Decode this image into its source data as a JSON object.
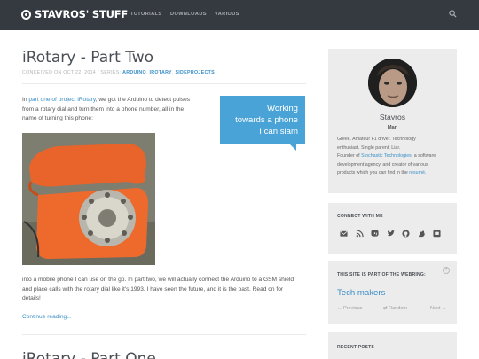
{
  "header": {
    "logo_text": "STAVROS' STUFF",
    "nav": [
      "TUTORIALS",
      "DOWNLOADS",
      "VARIOUS"
    ],
    "background": "#353a40"
  },
  "post": {
    "title": "iRotary - Part Two",
    "meta_prefix": "CONCEIVED ON OCT 22, 2014 / SERIES:",
    "tags": [
      "ARDUINO",
      "IROTARY",
      "SIDEPROJECTS"
    ],
    "intro_link": "part one of project iRotary",
    "intro_line1_a": "In ",
    "intro_line1_b": ", we got the Arduino to detect pulses",
    "intro_line2": "from a rotary dial and turn them into a phone number, all in the",
    "intro_line3": "name of turning this phone:",
    "callout_lines": [
      "Working",
      "towards a phone",
      "I can slam"
    ],
    "after_line1": "into a mobile phone I can use on the go. In part two, we will actually connect the Arduino to a GSM shield",
    "after_line2": "and place calls with the rotary dial like it's 1993. I have seen the future, and it is the past. Read on for",
    "after_line3": "details!",
    "continue": "Continue reading..."
  },
  "next_post": {
    "title": "iRotary - Part One"
  },
  "sidebar": {
    "profile": {
      "name": "Stavros",
      "role": "Man",
      "bio_line1": "Greek. Amateur F1 driver. Technology",
      "bio_line2": "enthusiast. Single parent. Liar.",
      "bio_line3_a": "Founder of ",
      "bio_line3_link": "Stochastic Technologies",
      "bio_line3_b": ", a software",
      "bio_line4": "development agency, and creator of various",
      "bio_line5_a": "products which you can find in the ",
      "bio_line5_link": "résumé",
      "bio_line5_b": "."
    },
    "connect": {
      "title": "CONNECT WITH ME",
      "icons": [
        "email-icon",
        "rss-icon",
        "mastodon-icon",
        "twitter-icon",
        "github-icon",
        "keybase-icon",
        "chat-icon"
      ]
    },
    "webring": {
      "title": "THIS SITE IS PART OF THE WEBRING:",
      "help": "?",
      "name": "Tech makers",
      "previous": "Previous",
      "random": "Random",
      "next": "Next"
    },
    "recent": {
      "title": "RECENT POSTS"
    }
  },
  "colors": {
    "accent": "#3a8fc7",
    "callout": "#4aa3d6",
    "sidebar_card": "#ececec"
  }
}
